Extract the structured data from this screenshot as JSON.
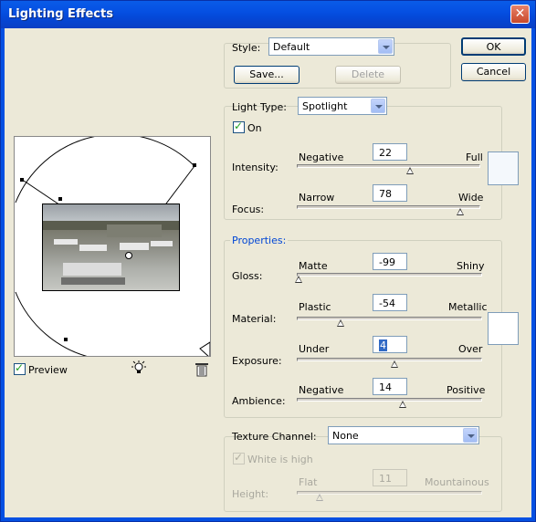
{
  "window": {
    "title": "Lighting Effects",
    "close_glyph": "✕"
  },
  "buttons": {
    "ok": "OK",
    "cancel": "Cancel",
    "save": "Save...",
    "delete": "Delete"
  },
  "style": {
    "label": "Style:",
    "value": "Default"
  },
  "light_type": {
    "label": "Light Type:",
    "value": "Spotlight",
    "on_label": "On",
    "on_checked": true
  },
  "intensity": {
    "label": "Intensity:",
    "left": "Negative",
    "right": "Full",
    "value": "22"
  },
  "focus": {
    "label": "Focus:",
    "left": "Narrow",
    "right": "Wide",
    "value": "78"
  },
  "light_color": "#f4f8fc",
  "properties": {
    "header": "Properties:",
    "gloss": {
      "label": "Gloss:",
      "left": "Matte",
      "right": "Shiny",
      "value": "-99"
    },
    "material": {
      "label": "Material:",
      "left": "Plastic",
      "right": "Metallic",
      "value": "-54"
    },
    "exposure": {
      "label": "Exposure:",
      "left": "Under",
      "right": "Over",
      "value": "4"
    },
    "ambience": {
      "label": "Ambience:",
      "left": "Negative",
      "right": "Positive",
      "value": "14"
    },
    "ambient_color": "#ffffff"
  },
  "texture": {
    "label": "Texture Channel:",
    "value": "None",
    "white_is_high_label": "White is high",
    "white_is_high_checked": true,
    "height": {
      "label": "Height:",
      "left": "Flat",
      "right": "Mountainous",
      "value": "11"
    }
  },
  "preview": {
    "label": "Preview",
    "checked": true
  },
  "colors": {
    "accent": "#0046d5",
    "title_bar": "#0550e2",
    "dialog": "#ece9d8"
  },
  "icons": {
    "light": "light-bulb-icon",
    "trash": "trash-icon"
  }
}
